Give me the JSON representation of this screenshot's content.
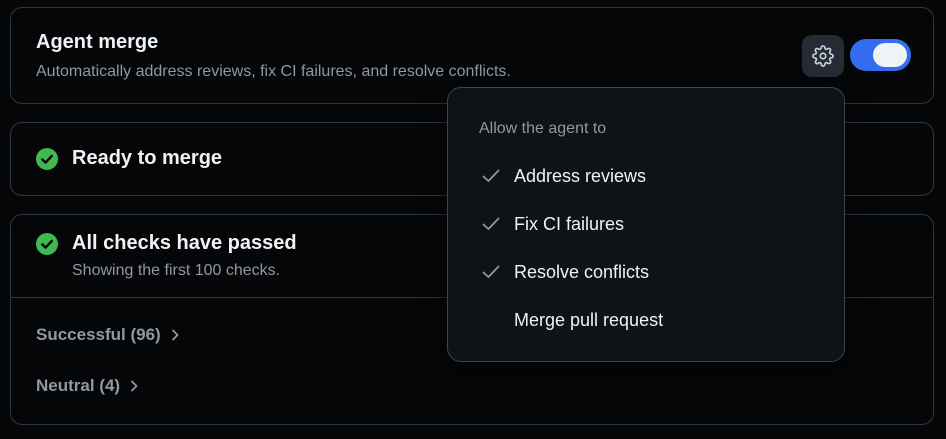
{
  "agent_merge": {
    "title": "Agent merge",
    "description": "Automatically address reviews, fix CI failures, and resolve conflicts.",
    "settings_icon": "gear-icon",
    "enabled": true,
    "accent_color": "#316dee"
  },
  "ready": {
    "title": "Ready to merge",
    "icon": "check-circle-icon",
    "color": "#3fb950"
  },
  "checks": {
    "title": "All checks have passed",
    "subtitle": "Showing the first 100 checks.",
    "groups": [
      {
        "label": "Successful (96)"
      },
      {
        "label": "Neutral (4)"
      }
    ]
  },
  "menu": {
    "heading": "Allow the agent to",
    "items": [
      {
        "label": "Address reviews",
        "checked": true
      },
      {
        "label": "Fix CI failures",
        "checked": true
      },
      {
        "label": "Resolve conflicts",
        "checked": true
      },
      {
        "label": "Merge pull request",
        "checked": false
      }
    ]
  }
}
